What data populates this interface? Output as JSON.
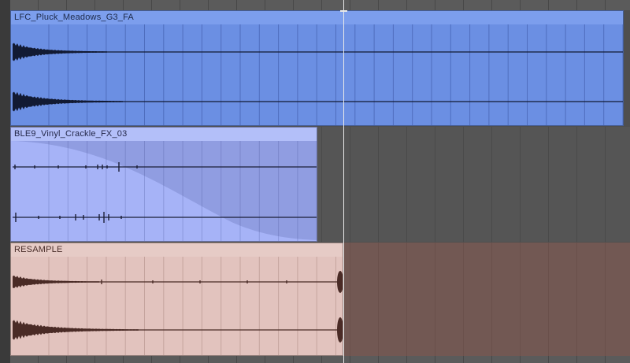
{
  "regions": [
    {
      "name": "LFC_Pluck_Meadows_G3_FA",
      "color": "#6b8fe3",
      "header_color": "#7c9eed",
      "text_color": "#1d2a4a",
      "wave_color": "#121a33"
    },
    {
      "name": "BLE9_Vinyl_Crackle_FX_03",
      "color": "#a6b3f7",
      "header_color": "#b3bff9",
      "text_color": "#24284a",
      "wave_color": "#1a1e36",
      "fade_color": "#8c99dd"
    },
    {
      "name": "RESAMPLE",
      "color": "#e2c3be",
      "header_color": "#e6cbc6",
      "text_color": "#4a2e2a",
      "wave_color": "#4a2b26",
      "lane_color": "#725853"
    }
  ]
}
